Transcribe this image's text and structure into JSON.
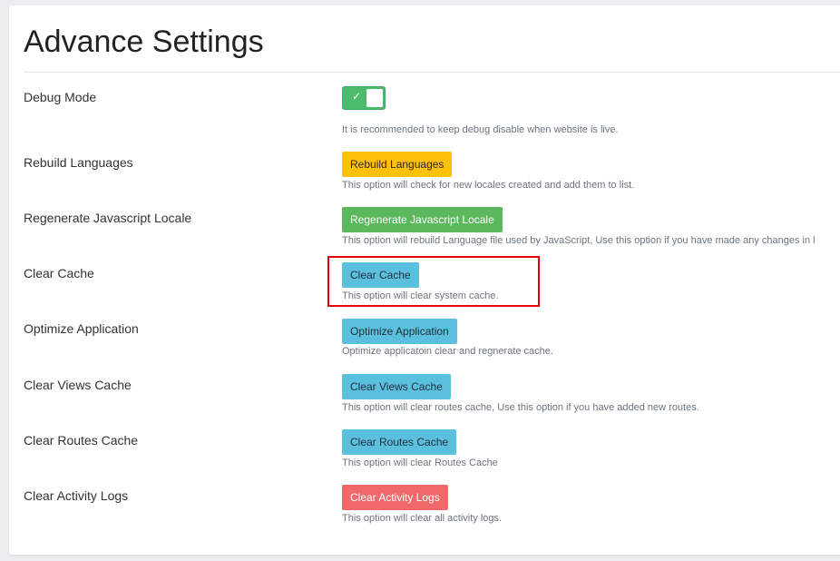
{
  "page": {
    "title": "Advance Settings"
  },
  "settings": [
    {
      "label": "Debug Mode",
      "control": "toggle",
      "toggle_state": "on",
      "toggle_check": "✓",
      "help": "It is recommended to keep debug disable when website is live."
    },
    {
      "label": "Rebuild Languages",
      "button": "Rebuild Languages",
      "variant": "warning",
      "help": "This option will check for new locales created and add them to list."
    },
    {
      "label": "Regenerate Javascript Locale",
      "button": "Regenerate Javascript Locale",
      "variant": "success",
      "help": "This option will rebuild Language file used by JavaScript, Use this option if you have made any changes in l"
    },
    {
      "label": "Clear Cache",
      "button": "Clear Cache",
      "variant": "info",
      "help": "This option will clear system cache.",
      "highlighted": true
    },
    {
      "label": "Optimize Application",
      "button": "Optimize Application",
      "variant": "info",
      "help": "Optimize applicatoin clear and regnerate cache."
    },
    {
      "label": "Clear Views Cache",
      "button": "Clear Views Cache",
      "variant": "info",
      "help": "This option will clear routes cache, Use this option if you have added new routes."
    },
    {
      "label": "Clear Routes Cache",
      "button": "Clear Routes Cache",
      "variant": "info",
      "help": "This option will clear Routes Cache"
    },
    {
      "label": "Clear Activity Logs",
      "button": "Clear Activity Logs",
      "variant": "danger",
      "help": "This option will clear all activity logs."
    }
  ],
  "colors": {
    "warning": "#ffc107",
    "success": "#5cb85c",
    "info": "#5bc0de",
    "danger": "#f0686a",
    "toggle_on": "#4cbb6c",
    "highlight_box": "#e60000"
  }
}
